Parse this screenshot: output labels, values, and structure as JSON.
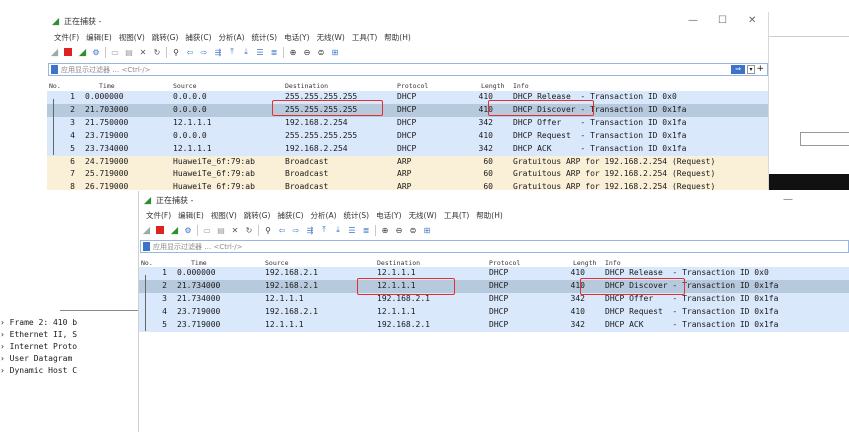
{
  "windows": [
    {
      "title": "正在捕获 -",
      "menus": [
        "文件(F)",
        "编辑(E)",
        "视图(V)",
        "跳转(G)",
        "捕获(C)",
        "分析(A)",
        "统计(S)",
        "电话(Y)",
        "无线(W)",
        "工具(T)",
        "帮助(H)"
      ],
      "filter_placeholder": "应用显示过滤器 … <Ctrl-/>",
      "columns": [
        "No.",
        "Time",
        "Source",
        "Destination",
        "Protocol",
        "Length",
        "Info"
      ],
      "packets": [
        {
          "no": "1",
          "time": "0.000000",
          "source": "0.0.0.0",
          "destination": "255.255.255.255",
          "protocol": "DHCP",
          "length": "410",
          "info": "DHCP Release  - Transaction ID 0x0",
          "kind": "udp"
        },
        {
          "no": "2",
          "time": "21.703000",
          "source": "0.0.0.0",
          "destination": "255.255.255.255",
          "protocol": "DHCP",
          "length": "410",
          "info": "DHCP Discover - Transaction ID 0x1fa",
          "kind": "sel"
        },
        {
          "no": "3",
          "time": "21.750000",
          "source": "12.1.1.1",
          "destination": "192.168.2.254",
          "protocol": "DHCP",
          "length": "342",
          "info": "DHCP Offer    - Transaction ID 0x1fa",
          "kind": "udp"
        },
        {
          "no": "4",
          "time": "23.719000",
          "source": "0.0.0.0",
          "destination": "255.255.255.255",
          "protocol": "DHCP",
          "length": "410",
          "info": "DHCP Request  - Transaction ID 0x1fa",
          "kind": "udp"
        },
        {
          "no": "5",
          "time": "23.734000",
          "source": "12.1.1.1",
          "destination": "192.168.2.254",
          "protocol": "DHCP",
          "length": "342",
          "info": "DHCP ACK      - Transaction ID 0x1fa",
          "kind": "udp"
        },
        {
          "no": "6",
          "time": "24.719000",
          "source": "HuaweiTe_6f:79:ab",
          "destination": "Broadcast",
          "protocol": "ARP",
          "length": "60",
          "info": "Gratuitous ARP for 192.168.2.254 (Request)",
          "kind": "arp"
        },
        {
          "no": "7",
          "time": "25.719000",
          "source": "HuaweiTe_6f:79:ab",
          "destination": "Broadcast",
          "protocol": "ARP",
          "length": "60",
          "info": "Gratuitous ARP for 192.168.2.254 (Request)",
          "kind": "arp"
        },
        {
          "no": "8",
          "time": "26.719000",
          "source": "HuaweiTe_6f:79:ab",
          "destination": "Broadcast",
          "protocol": "ARP",
          "length": "60",
          "info": "Gratuitous ARP for 192.168.2.254 (Request)",
          "kind": "arp"
        }
      ]
    },
    {
      "title": "正在捕获 -",
      "menus": [
        "文件(F)",
        "编辑(E)",
        "视图(V)",
        "跳转(G)",
        "捕获(C)",
        "分析(A)",
        "统计(S)",
        "电话(Y)",
        "无线(W)",
        "工具(T)",
        "帮助(H)"
      ],
      "filter_placeholder": "应用显示过滤器 … <Ctrl-/>",
      "columns": [
        "No.",
        "Time",
        "Source",
        "Destination",
        "Protocol",
        "Length",
        "Info"
      ],
      "packets": [
        {
          "no": "1",
          "time": "0.000000",
          "source": "192.168.2.1",
          "destination": "12.1.1.1",
          "protocol": "DHCP",
          "length": "410",
          "info": "DHCP Release  - Transaction ID 0x0",
          "kind": "udp"
        },
        {
          "no": "2",
          "time": "21.734000",
          "source": "192.168.2.1",
          "destination": "12.1.1.1",
          "protocol": "DHCP",
          "length": "410",
          "info": "DHCP Discover - Transaction ID 0x1fa",
          "kind": "sel"
        },
        {
          "no": "3",
          "time": "21.734000",
          "source": "12.1.1.1",
          "destination": "192.168.2.1",
          "protocol": "DHCP",
          "length": "342",
          "info": "DHCP Offer    - Transaction ID 0x1fa",
          "kind": "udp"
        },
        {
          "no": "4",
          "time": "23.719000",
          "source": "192.168.2.1",
          "destination": "12.1.1.1",
          "protocol": "DHCP",
          "length": "410",
          "info": "DHCP Request  - Transaction ID 0x1fa",
          "kind": "udp"
        },
        {
          "no": "5",
          "time": "23.719000",
          "source": "12.1.1.1",
          "destination": "192.168.2.1",
          "protocol": "DHCP",
          "length": "342",
          "info": "DHCP ACK      - Transaction ID 0x1fa",
          "kind": "udp"
        }
      ]
    }
  ],
  "details_tree": [
    "Frame 2: 410 b",
    "Ethernet II, S",
    "Internet Proto",
    "User Datagram",
    "Dynamic Host C"
  ],
  "colors": {
    "udp_row": "#dae8fc",
    "selected_row": "#b7c9dd",
    "arp_row": "#faf0d7",
    "highlight_box": "#e03030",
    "accent": "#3b74c8"
  }
}
